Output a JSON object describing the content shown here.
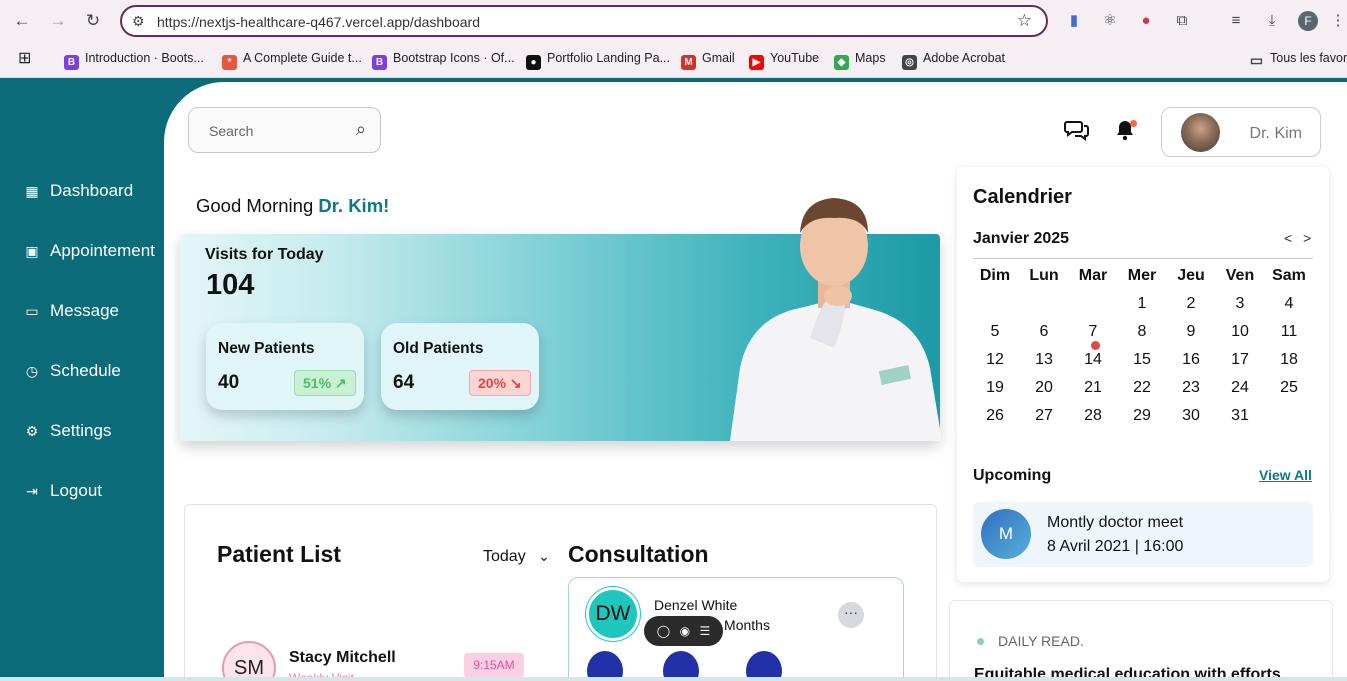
{
  "browser": {
    "url": "https://nextjs-healthcare-q467.vercel.app/dashboard",
    "profile_initial": "F",
    "bookmarks": [
      {
        "label": "Introduction · Boots...",
        "color": "#7b3fe4",
        "glyph": "B"
      },
      {
        "label": "A Complete Guide t...",
        "color": "#e4573f",
        "glyph": "*"
      },
      {
        "label": "Bootstrap Icons · Of...",
        "color": "#7b3fe4",
        "glyph": "B"
      },
      {
        "label": "Portfolio Landing Pa...",
        "color": "#111111",
        "glyph": "●"
      },
      {
        "label": "Gmail",
        "color": "#d93025",
        "glyph": "M"
      },
      {
        "label": "YouTube",
        "color": "#ff0000",
        "glyph": "▶"
      },
      {
        "label": "Maps",
        "color": "#34a853",
        "glyph": "◆"
      },
      {
        "label": "Adobe Acrobat",
        "color": "#444444",
        "glyph": "◎"
      }
    ],
    "all_bookmarks": "Tous les favori"
  },
  "sidebar": {
    "items": [
      {
        "label": "Dashboard",
        "icon": "dashboard-icon"
      },
      {
        "label": "Appointement",
        "icon": "calendar-icon"
      },
      {
        "label": "Message",
        "icon": "message-icon"
      },
      {
        "label": "Schedule",
        "icon": "clock-icon"
      },
      {
        "label": "Settings",
        "icon": "gear-icon"
      },
      {
        "label": "Logout",
        "icon": "logout-icon"
      }
    ]
  },
  "header": {
    "search_placeholder": "Search",
    "user_name": "Dr. Kim"
  },
  "greeting": {
    "prefix": "Good Morning ",
    "name": "Dr. Kim!"
  },
  "visits": {
    "title": "Visits for Today",
    "count": "104",
    "new_patients": {
      "label": "New Patients",
      "value": "40",
      "change": "51%"
    },
    "old_patients": {
      "label": "Old Patients",
      "value": "64",
      "change": "20%"
    }
  },
  "patient_list": {
    "title": "Patient List",
    "filter": "Today",
    "items": [
      {
        "initials": "SM",
        "name": "Stacy Mitchell",
        "subtitle": "Weekly Visit",
        "time": "9:15AM"
      }
    ]
  },
  "consultation": {
    "title": "Consultation",
    "initials": "DW",
    "name": "Denzel White",
    "age": "28 Years 3 Months"
  },
  "calendar": {
    "title": "Calendrier",
    "month": "Janvier 2025",
    "prev": "<",
    "next": ">",
    "weekdays": [
      "Dim",
      "Lun",
      "Mar",
      "Mer",
      "Jeu",
      "Ven",
      "Sam"
    ],
    "first_weekday_index": 3,
    "days_in_month": 31,
    "marked_day": 7
  },
  "upcoming": {
    "title": "Upcoming",
    "view_all": "View All",
    "initial": "M",
    "event": "Montly doctor meet",
    "datetime": "8 Avril 2021 | 16:00"
  },
  "daily_read": {
    "label": "DAILY READ.",
    "headline": "Equitable medical education with efforts"
  }
}
